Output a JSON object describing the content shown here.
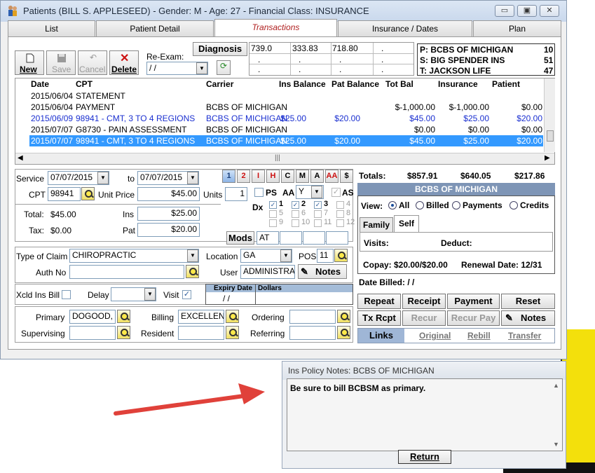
{
  "window": {
    "title": "Patients (BILL S. APPLESEED) - Gender: M - Age: 27 - Financial Class: INSURANCE",
    "controls": {
      "min": "▭",
      "max": "▣",
      "close": "✕"
    }
  },
  "tabs": [
    "List",
    "Patient Detail",
    "Transactions",
    "Insurance / Dates",
    "Plan"
  ],
  "toolbar": {
    "new": "New",
    "save": "Save",
    "cancel": "Cancel",
    "delete": "Delete",
    "reexam_label": "Re-Exam:",
    "reexam_value": " / /",
    "diagnosis": "Diagnosis"
  },
  "dx_grid": [
    [
      "739.0",
      "333.83",
      "718.80",
      "."
    ],
    [
      ".",
      ".",
      ".",
      "."
    ],
    [
      ".",
      ".",
      ".",
      "."
    ]
  ],
  "insurance_box": [
    {
      "label": "P: BCBS OF MICHIGAN",
      "num": "10"
    },
    {
      "label": "S: BIG SPENDER INS",
      "num": "51"
    },
    {
      "label": "T: JACKSON LIFE",
      "num": "47"
    }
  ],
  "table": {
    "headers": [
      "Date",
      "CPT",
      "Carrier",
      "Ins Balance",
      "Pat Balance",
      "Tot Bal",
      "Insurance",
      "Patient"
    ],
    "rows": [
      {
        "date": "2015/06/04",
        "cpt": "STATEMENT",
        "carrier": "",
        "ins": "",
        "pat": "",
        "tot": "",
        "insurance": "",
        "patient": "",
        "style": "black"
      },
      {
        "date": "2015/06/04",
        "cpt": "PAYMENT",
        "carrier": "BCBS OF MICHIGAN",
        "ins": "",
        "pat": "",
        "tot": "$-1,000.00",
        "insurance": "$-1,000.00",
        "patient": "$0.00",
        "style": "black"
      },
      {
        "date": "2015/06/09",
        "cpt": "98941 - CMT, 3 TO 4 REGIONS",
        "carrier": "BCBS OF MICHIGAN",
        "ins": "$25.00",
        "pat": "$20.00",
        "tot": "$45.00",
        "insurance": "$25.00",
        "patient": "$20.00",
        "style": "blue"
      },
      {
        "date": "2015/07/07",
        "cpt": "G8730 - PAIN ASSESSMENT",
        "carrier": "BCBS OF MICHIGAN",
        "ins": "",
        "pat": "",
        "tot": "$0.00",
        "insurance": "$0.00",
        "patient": "$0.00",
        "style": "black"
      },
      {
        "date": "2015/07/07",
        "cpt": "98941 - CMT, 3 TO 4 REGIONS",
        "carrier": "BCBS OF MICHIGAN",
        "ins": "$25.00",
        "pat": "$20.00",
        "tot": "$45.00",
        "insurance": "$25.00",
        "patient": "$20.00",
        "style": "selected"
      }
    ]
  },
  "form": {
    "service_label": "Service",
    "service_from": "07/07/2015",
    "to_label": "to",
    "service_to": "07/07/2015",
    "cpt_label": "CPT",
    "cpt_value": "98941",
    "unit_price_label": "Unit Price",
    "unit_price": "$45.00",
    "units_label": "Units",
    "units": "1",
    "total_label": "Total:",
    "total": "$45.00",
    "ins_label": "Ins",
    "ins": "$25.00",
    "tax_label": "Tax:",
    "tax": "$0.00",
    "pat_label": "Pat",
    "pat": "$20.00",
    "mods": "Mods",
    "mod1": "AT",
    "type_of_claim_label": "Type of Claim",
    "type_of_claim": "CHIROPRACTIC",
    "location_label": "Location",
    "location": "GA",
    "pos_label": "POS",
    "pos": "11",
    "auth_label": "Auth No",
    "user_label": "User",
    "user": "ADMINISTRAT",
    "notes": "Notes",
    "xcld_label": "Xcld Ins Bill",
    "delay_label": "Delay",
    "visit_label": "Visit",
    "expiry_label": "Expiry Date",
    "dollars_label": "Dollars",
    "expiry_value": " / /",
    "primary_label": "Primary",
    "primary": "DOGOOD, F",
    "billing_label": "Billing",
    "billing": "EXCELLENT",
    "ordering_label": "Ordering",
    "supervising_label": "Supervising",
    "resident_label": "Resident",
    "referring_label": "Referring",
    "ps": "PS",
    "aa": "AA",
    "aa_value": "Y",
    "as": "AS",
    "dx_label": "Dx",
    "dx_nums": [
      "1",
      "2",
      "3",
      "4",
      "5",
      "6",
      "7",
      "8",
      "9",
      "10",
      "11",
      "12"
    ]
  },
  "mod_buttons": [
    "1",
    "2",
    "I",
    "H",
    "C",
    "M",
    "A",
    "AA",
    "$"
  ],
  "totals": {
    "label": "Totals:",
    "tot": "$857.91",
    "ins": "$640.05",
    "pat": "$217.86"
  },
  "insurance_panel": {
    "title": "BCBS OF MICHIGAN",
    "view_label": "View:",
    "view_options": [
      "All",
      "Billed",
      "Payments",
      "Credits"
    ],
    "subtabs": [
      "Family",
      "Self"
    ],
    "visits_label": "Visits:",
    "deduct_label": "Deduct:",
    "copay": "Copay: $20.00/$20.00",
    "renewal": "Renewal Date: 12/31"
  },
  "date_billed": "Date Billed:  / /",
  "action_buttons": [
    "Repeat",
    "Receipt",
    "Payment",
    "Reset",
    "Tx Rcpt",
    "Recur Log",
    "Recur Pay",
    "Notes"
  ],
  "links": [
    "Links",
    "Original",
    "Rebill",
    "Transfer"
  ],
  "notes_window": {
    "title": "Ins Policy Notes: BCBS OF MICHIGAN",
    "text": "Be sure to bill BCBSM as primary.",
    "button": "Return"
  },
  "colors": {
    "accent": "#3399ff",
    "blue_text": "#1a2fd0",
    "arrow": "#e0413a",
    "panel_header": "#7e95b6"
  }
}
